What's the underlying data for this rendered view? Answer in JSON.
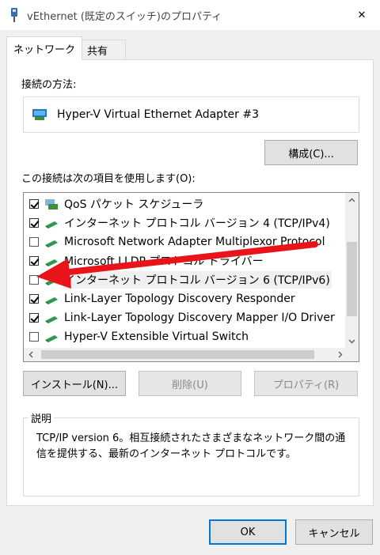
{
  "window": {
    "title": "vEthernet (既定のスイッチ)のプロパティ",
    "close_glyph": "✕"
  },
  "tabs": [
    {
      "label": "ネットワーク",
      "active": true
    },
    {
      "label": "共有",
      "active": false
    }
  ],
  "connection": {
    "label": "接続の方法:",
    "adapter_name": "Hyper-V Virtual Ethernet Adapter #3",
    "configure_button": "構成(C)..."
  },
  "items_section": {
    "label": "この接続は次の項目を使用します(O):",
    "items": [
      {
        "label": "QoS パケット スケジューラ",
        "checked": true,
        "icon": "qos-icon"
      },
      {
        "label": "インターネット プロトコル バージョン 4 (TCP/IPv4)",
        "checked": true,
        "icon": "protocol-icon"
      },
      {
        "label": "Microsoft Network Adapter Multiplexor Protocol",
        "checked": false,
        "icon": "protocol-icon"
      },
      {
        "label": "Microsoft LLDP プロトコル ドライバー",
        "checked": true,
        "icon": "protocol-icon"
      },
      {
        "label": "インターネット プロトコル バージョン 6 (TCP/IPv6)",
        "checked": false,
        "icon": "protocol-icon",
        "selected": true
      },
      {
        "label": "Link-Layer Topology Discovery Responder",
        "checked": true,
        "icon": "protocol-icon"
      },
      {
        "label": "Link-Layer Topology Discovery Mapper I/O Driver",
        "checked": true,
        "icon": "protocol-icon"
      },
      {
        "label": "Hyper-V Extensible Virtual Switch",
        "checked": false,
        "icon": "protocol-icon"
      }
    ]
  },
  "actions": {
    "install": "インストール(N)...",
    "uninstall": "削除(U)",
    "properties": "プロパティ(R)"
  },
  "description": {
    "legend": "説明",
    "text": "TCP/IP version 6。相互接続されたさまざまなネットワーク間の通信を提供する、最新のインターネット プロトコルです。"
  },
  "footer": {
    "ok": "OK",
    "cancel": "キャンセル"
  },
  "colors": {
    "accent": "#0078d7",
    "annotation_arrow": "#e8141a"
  }
}
